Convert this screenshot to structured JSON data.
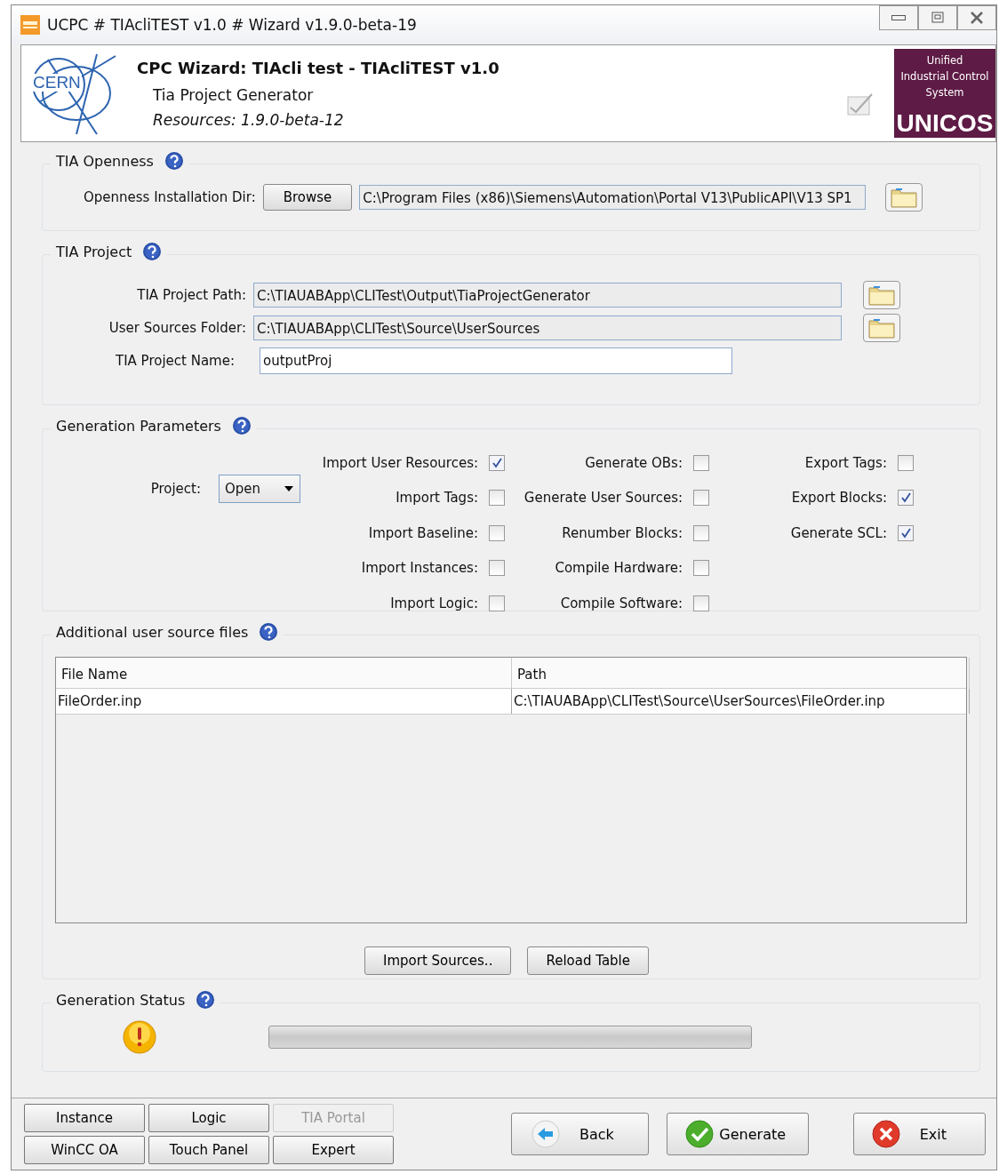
{
  "window": {
    "title": "UCPC # TIAcliTEST v1.0 # Wizard v1.9.0-beta-19"
  },
  "header": {
    "title": "CPC Wizard: TIAcli test - TIAcliTEST v1.0",
    "subtitle": "Tia Project Generator",
    "resources": "Resources: 1.9.0-beta-12",
    "logo_text": "CERN",
    "badge_lines": [
      "Unified",
      "Industrial Control",
      "System"
    ],
    "badge_name": "UNICOS"
  },
  "openness": {
    "title": "TIA Openness",
    "label": "Openness Installation Dir:",
    "button": "Browse",
    "value": "C:\\Program Files (x86)\\Siemens\\Automation\\Portal V13\\PublicAPI\\V13 SP1"
  },
  "project": {
    "title": "TIA Project",
    "fields": [
      {
        "kind": "path",
        "label": "TIA Project Path:",
        "value": "C:\\TIAUABApp\\CLITest\\Output\\TiaProjectGenerator"
      },
      {
        "kind": "path",
        "label": "User Sources Folder:",
        "value": "C:\\TIAUABApp\\CLITest\\Source\\UserSources"
      },
      {
        "kind": "text",
        "label": "TIA Project Name:",
        "value": "outputProj"
      }
    ]
  },
  "generation": {
    "title": "Generation Parameters",
    "project_label": "Project:",
    "project_value": "Open",
    "columns": [
      [
        {
          "label": "Import User Resources:",
          "checked": true
        },
        {
          "label": "Import Tags:",
          "checked": false
        },
        {
          "label": "Import Baseline:",
          "checked": false
        },
        {
          "label": "Import Instances:",
          "checked": false
        },
        {
          "label": "Import Logic:",
          "checked": false
        }
      ],
      [
        {
          "label": "Generate OBs:",
          "checked": false
        },
        {
          "label": "Generate User Sources:",
          "checked": false
        },
        {
          "label": "Renumber Blocks:",
          "checked": false
        },
        {
          "label": "Compile Hardware:",
          "checked": false
        },
        {
          "label": "Compile Software:",
          "checked": false
        }
      ],
      [
        {
          "label": "Export Tags:",
          "checked": false
        },
        {
          "label": "Export Blocks:",
          "checked": true
        },
        {
          "label": "Generate SCL:",
          "checked": true
        }
      ]
    ]
  },
  "sources": {
    "title": "Additional user source files",
    "table": {
      "columns": [
        "File Name",
        "Path"
      ],
      "rows": [
        [
          "FileOrder.inp",
          "C:\\TIAUABApp\\CLITest\\Source\\UserSources\\FileOrder.inp"
        ]
      ]
    },
    "buttons": [
      "Import Sources..",
      "Reload Table"
    ]
  },
  "status": {
    "title": "Generation Status",
    "level": 0
  },
  "modes": [
    {
      "label": "Instance",
      "disabled": false
    },
    {
      "label": "Logic",
      "disabled": false
    },
    {
      "label": "TIA Portal",
      "disabled": true
    },
    {
      "label": "WinCC OA",
      "disabled": false
    },
    {
      "label": "Touch Panel",
      "disabled": false
    },
    {
      "label": "Expert",
      "disabled": false
    }
  ],
  "actions": [
    {
      "kind": "back",
      "label": "Back"
    },
    {
      "kind": "generate",
      "label": "Generate"
    },
    {
      "kind": "exit",
      "label": "Exit"
    }
  ]
}
